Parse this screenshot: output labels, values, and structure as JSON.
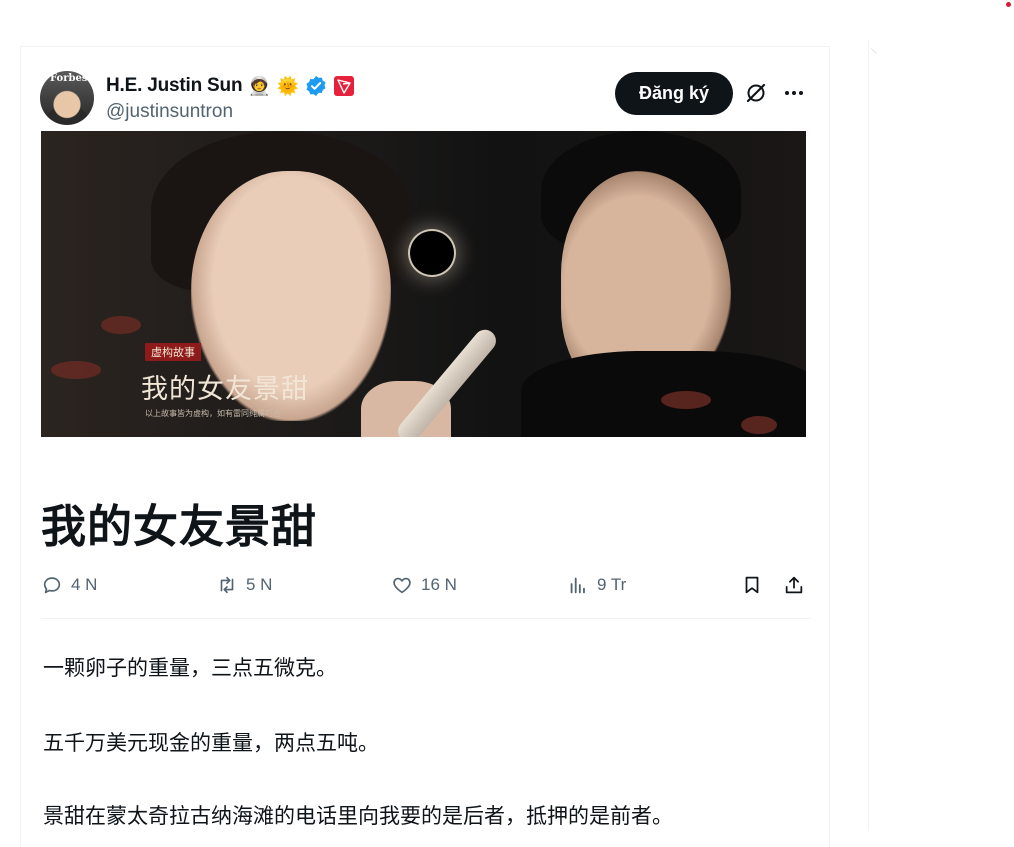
{
  "author": {
    "display_name": "H.E. Justin Sun",
    "badges": [
      "🧑‍🚀",
      "🌞"
    ],
    "handle": "@justinsuntron",
    "avatar_text": "Forbes"
  },
  "header": {
    "subscribe_label": "Đăng ký",
    "icons": [
      "grok-icon",
      "more-icon"
    ]
  },
  "cover_image": {
    "tag": "虚构故事",
    "title": "我的女友景甜",
    "note": "以上故事皆为虚构，如有雷同纯属巧合"
  },
  "article": {
    "title": "我的女友景甜",
    "paragraphs": [
      "一颗卵子的重量，三点五微克。",
      "五千万美元现金的重量，两点五吨。",
      "景甜在蒙太奇拉古纳海滩的电话里向我要的是后者，抵押的是前者。"
    ]
  },
  "actions": {
    "replies": "4 N",
    "reposts": "5 N",
    "likes": "16 N",
    "views": "9 Tr"
  },
  "colors": {
    "text": "#0f1419",
    "secondary": "#536471",
    "button_bg": "#0f1419",
    "verified": "#1d9bf0",
    "tron_red": "#e5213b"
  }
}
